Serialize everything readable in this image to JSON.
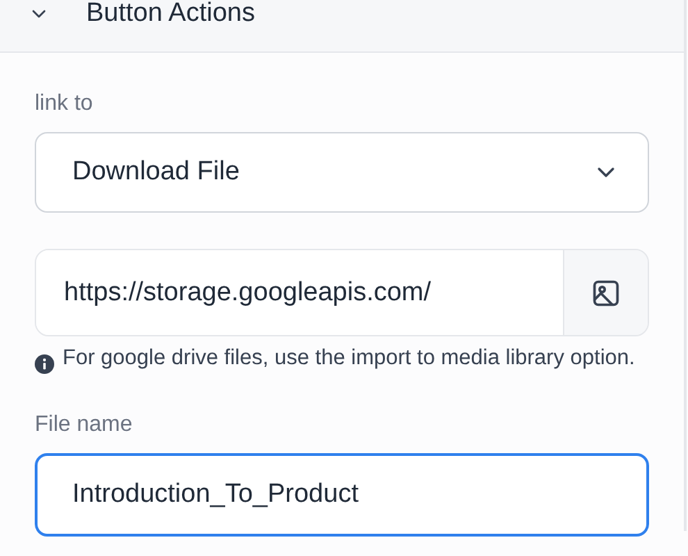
{
  "section": {
    "title": "Button Actions",
    "expanded": true
  },
  "link_to": {
    "label": "link to",
    "value": "Download File"
  },
  "url_field": {
    "value": "https://storage.googleapis.com/"
  },
  "hint": "For google drive files, use the import to media library option.",
  "file_name": {
    "label": "File name",
    "value": "Introduction_To_Product",
    "focused": true
  }
}
